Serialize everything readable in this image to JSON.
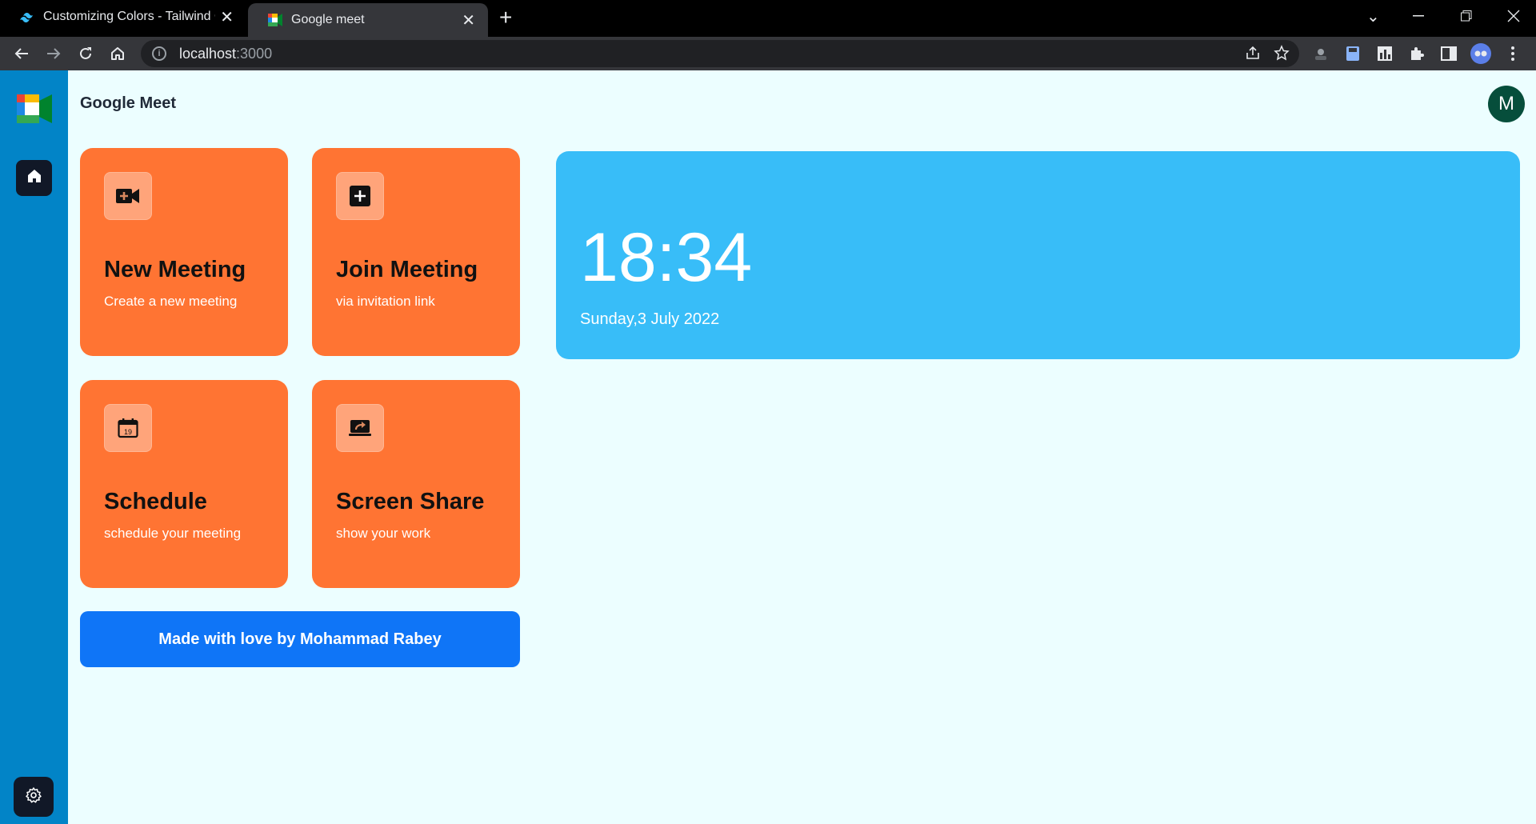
{
  "browser": {
    "tabs": [
      {
        "title": "Customizing Colors - Tailwind CS",
        "active": false
      },
      {
        "title": "Google meet",
        "active": true
      }
    ],
    "address": {
      "host": "localhost",
      "port": ":3000"
    }
  },
  "app": {
    "title": "Google Meet",
    "avatar_initial": "M"
  },
  "cards": [
    {
      "title": "New Meeting",
      "subtitle": "Create a new meeting",
      "icon": "video-add-icon"
    },
    {
      "title": "Join Meeting",
      "subtitle": "via invitation link",
      "icon": "plus-square-icon"
    },
    {
      "title": "Schedule",
      "subtitle": "schedule your meeting",
      "icon": "calendar-icon",
      "icon_text": "19"
    },
    {
      "title": "Screen Share",
      "subtitle": "show your work",
      "icon": "screen-share-icon"
    }
  ],
  "footer": {
    "label": "Made with love by Mohammad Rabey"
  },
  "clock": {
    "time": "18:34",
    "date": "Sunday,3 July 2022"
  },
  "colors": {
    "sidebar": "#0284c7",
    "card": "#ff7433",
    "clock_panel": "#38bdf8",
    "footer_button": "#0f75f7",
    "page_background": "#ecfeff"
  }
}
